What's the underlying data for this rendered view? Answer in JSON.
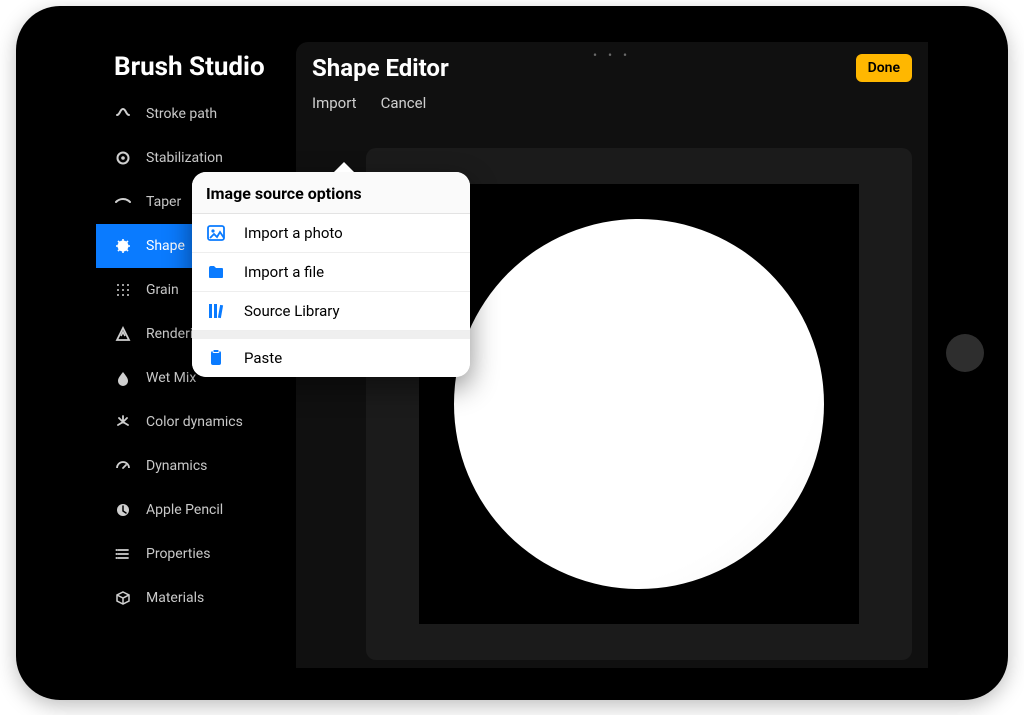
{
  "studio": {
    "title": "Brush Studio",
    "sidebar": [
      {
        "label": "Stroke path",
        "icon": "strokepath-icon",
        "active": false
      },
      {
        "label": "Stabilization",
        "icon": "stabilize-icon",
        "active": false
      },
      {
        "label": "Taper",
        "icon": "taper-icon",
        "active": false
      },
      {
        "label": "Shape",
        "icon": "shape-icon",
        "active": true
      },
      {
        "label": "Grain",
        "icon": "grain-icon",
        "active": false
      },
      {
        "label": "Rendering",
        "icon": "render-icon",
        "active": false
      },
      {
        "label": "Wet Mix",
        "icon": "wetmix-icon",
        "active": false
      },
      {
        "label": "Color dynamics",
        "icon": "colordyn-icon",
        "active": false
      },
      {
        "label": "Dynamics",
        "icon": "dynamics-icon",
        "active": false
      },
      {
        "label": "Apple Pencil",
        "icon": "pencil-icon",
        "active": false
      },
      {
        "label": "Properties",
        "icon": "properties-icon",
        "active": false
      },
      {
        "label": "Materials",
        "icon": "materials-icon",
        "active": false
      }
    ]
  },
  "editor": {
    "title": "Shape Editor",
    "done": "Done",
    "grab": "• • •",
    "actions": {
      "import": "Import",
      "cancel": "Cancel"
    }
  },
  "popover": {
    "title": "Image source options",
    "items": [
      {
        "label": "Import a photo",
        "icon": "photo-icon",
        "sep": false
      },
      {
        "label": "Import a file",
        "icon": "folder-icon",
        "sep": false
      },
      {
        "label": "Source Library",
        "icon": "library-icon",
        "sep": false
      },
      {
        "label": "Paste",
        "icon": "paste-icon",
        "sep": true
      }
    ]
  },
  "colors": {
    "accent": "#0a7bff",
    "done": "#ffb700"
  }
}
